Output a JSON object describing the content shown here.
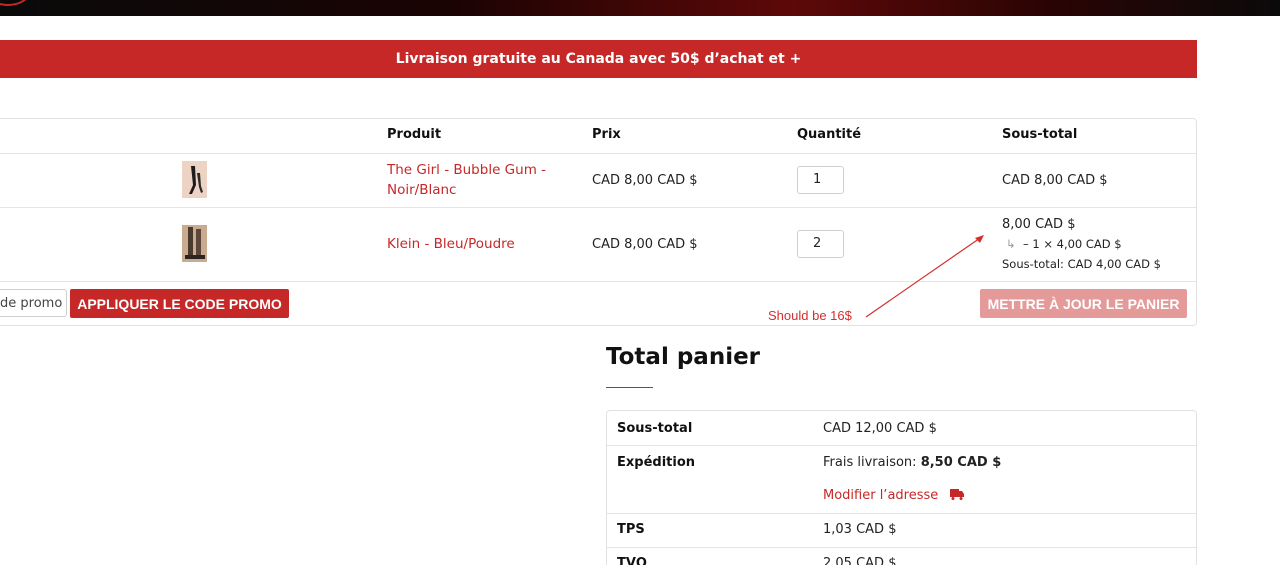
{
  "banner": {
    "text": "Livraison gratuite au Canada avec 50$ d’achat et +"
  },
  "cart": {
    "headers": {
      "product": "Produit",
      "price": "Prix",
      "quantity": "Quantité",
      "subtotal": "Sous-total"
    },
    "rows": [
      {
        "product_name": "The Girl - Bubble Gum - Noir/Blanc",
        "price": "CAD 8,00 CAD $",
        "quantity": "1",
        "subtotal": "CAD 8,00 CAD $"
      },
      {
        "product_name": "Klein - Bleu/Poudre",
        "price": "CAD 8,00 CAD $",
        "quantity": "2",
        "subtotal": "8,00 CAD $",
        "discount_line": "– 1 × 4,00 CAD $",
        "discount_hook": "↳",
        "discount_subtotal": "Sous-total: CAD 4,00 CAD $"
      }
    ],
    "promo_placeholder": "Code promo",
    "apply_button": "APPLIQUER LE CODE PROMO",
    "update_button": "METTRE À JOUR LE PANIER"
  },
  "annotation": {
    "text": "Should be 16$",
    "color": "#d32f2f"
  },
  "totals": {
    "title": "Total panier",
    "rows": [
      {
        "label": "Sous-total",
        "value": "CAD 12,00 CAD $"
      },
      {
        "label": "Expédition",
        "value_prefix": "Frais livraison:",
        "value_bold": "8,50 CAD $",
        "link": "Modifier l’adresse",
        "icon": "truck-icon"
      },
      {
        "label": "TPS",
        "value": "1,03 CAD $"
      },
      {
        "label": "TVQ",
        "value": "2,05 CAD $"
      }
    ]
  },
  "colors": {
    "accent": "#c62828",
    "update_button": "#e59a9a",
    "annotation": "#d32f2f"
  }
}
